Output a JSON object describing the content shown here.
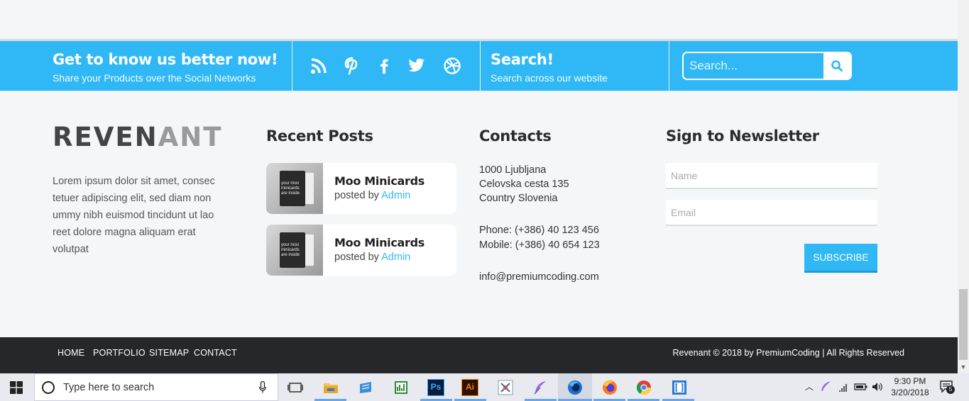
{
  "social_bar": {
    "title": "Get to know us better now!",
    "subtitle": "Share your Products over the Social Networks",
    "icons": [
      "rss-icon",
      "pinterest-icon",
      "facebook-icon",
      "twitter-icon",
      "dribbble-icon"
    ],
    "search_title": "Search!",
    "search_subtitle": "Search across our website",
    "search_placeholder": "Search..."
  },
  "footer": {
    "logo_dark": "REVEN",
    "logo_light": "ANT",
    "about": "Lorem ipsum dolor sit amet, consec tetuer adipiscing elit, sed diam non ummy nibh euismod tincidunt ut lao reet dolore magna aliquam erat volutpat",
    "recent_posts": {
      "title": "Recent Posts",
      "posts": [
        {
          "title": "Moo Minicards",
          "by": "posted by",
          "author": "Admin",
          "thumb_text": "your moo minicards are inside"
        },
        {
          "title": "Moo Minicards",
          "by": "posted by",
          "author": "Admin",
          "thumb_text": "your moo minicards are inside"
        }
      ]
    },
    "contacts": {
      "title": "Contacts",
      "address": [
        "1000 Ljubljana",
        "Celovska cesta 135",
        "Country Slovenia"
      ],
      "phone": "Phone: (+386) 40 123 456",
      "mobile": "Mobile: (+386) 40 654 123",
      "email": "info@premiumcoding.com"
    },
    "newsletter": {
      "title": "Sign to Newsletter",
      "name_placeholder": "Name",
      "email_placeholder": "Email",
      "button": "SUBSCRIBE"
    }
  },
  "bottom_bar": {
    "nav": [
      "HOME",
      "PORTFOLIO",
      "SITEMAP",
      "CONTACT"
    ],
    "copyright": "Revenant © 2018 by PremiumCoding | All Rights Reserved"
  },
  "taskbar": {
    "search_text": "Type here to search",
    "time": "9:30 PM",
    "date": "3/20/2018",
    "notification_count": "5"
  },
  "colors": {
    "accent": "#2fb8f5",
    "dark_bar": "#25272b",
    "background": "#f4f6f8"
  }
}
